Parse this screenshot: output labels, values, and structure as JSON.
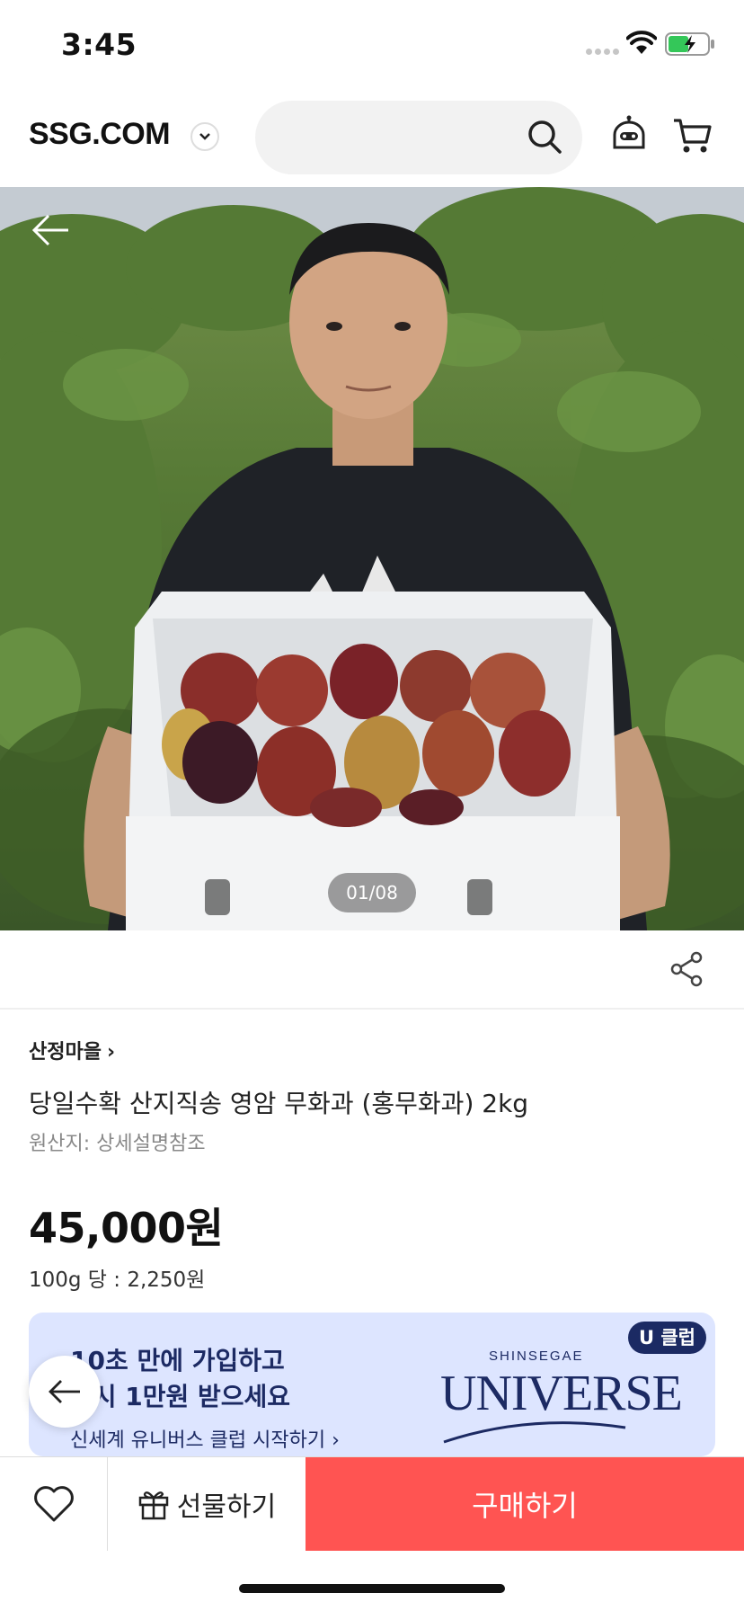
{
  "status_bar": {
    "time": "3:45"
  },
  "header": {
    "logo": "SSG.COM",
    "search_placeholder": ""
  },
  "gallery": {
    "counter": "01/08"
  },
  "product": {
    "seller": "산정마을",
    "title": "당일수확 산지직송 영암 무화과 (홍무화과) 2kg",
    "origin": "원산지: 상세설명참조",
    "price": "45,000원",
    "unit_price": "100g 당 : 2,250원"
  },
  "banner": {
    "line1": "10초 만에 가입하고",
    "line2": "즉시 1만원 받으세요",
    "link": "신세계 유니버스 클럽 시작하기",
    "badge": "U 클럽",
    "brand_small": "SHINSEGAE",
    "brand_big": "UNIVERSE"
  },
  "bottom_bar": {
    "gift_label": "선물하기",
    "buy_label": "구매하기"
  },
  "colors": {
    "buy_button": "#ff5452",
    "banner_bg": "#dde5ff",
    "banner_text": "#1c2a63"
  },
  "icons": [
    "search-icon",
    "chatbot-icon",
    "cart-icon",
    "back-arrow-icon",
    "share-icon",
    "heart-icon",
    "gift-icon",
    "chevron-down-icon",
    "chevron-right-icon",
    "wifi-icon",
    "battery-icon"
  ]
}
